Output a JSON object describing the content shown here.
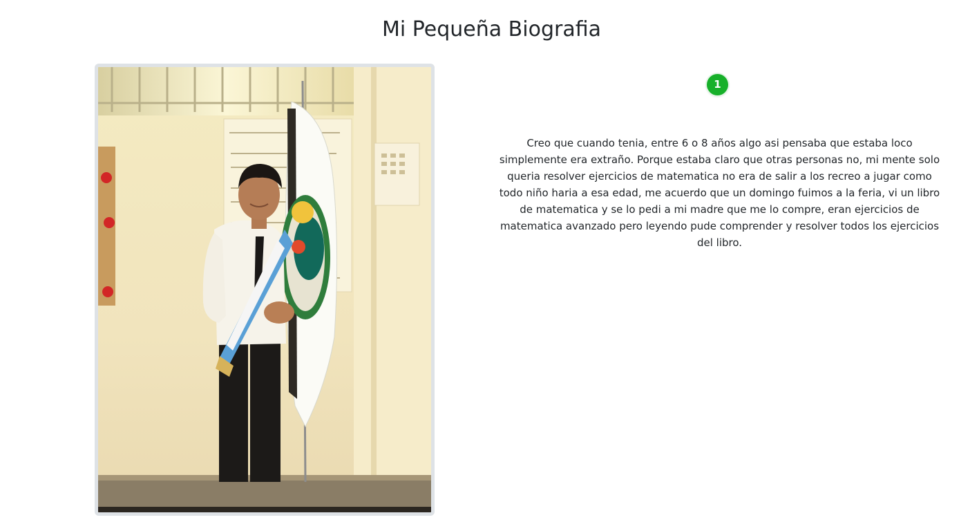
{
  "page": {
    "title": "Mi Pequeña Biografia"
  },
  "photo": {
    "subject": "student-with-flag-photo"
  },
  "step": {
    "number": "1",
    "color": "#17b02a"
  },
  "bio": {
    "text": "Creo que cuando tenia, entre 6 o 8 años algo asi pensaba que estaba loco simplemente era extraño. Porque estaba claro que otras personas no, mi mente solo queria resolver ejercicios de matematica no era de salir a los recreo a jugar como todo niño haria a esa edad, me acuerdo que un domingo fuimos a la feria, vi un libro de matematica y se lo pedi a mi madre que me lo compre, eran ejercicios de matematica avanzado pero leyendo pude comprender y resolver todos los ejercicios del libro."
  }
}
